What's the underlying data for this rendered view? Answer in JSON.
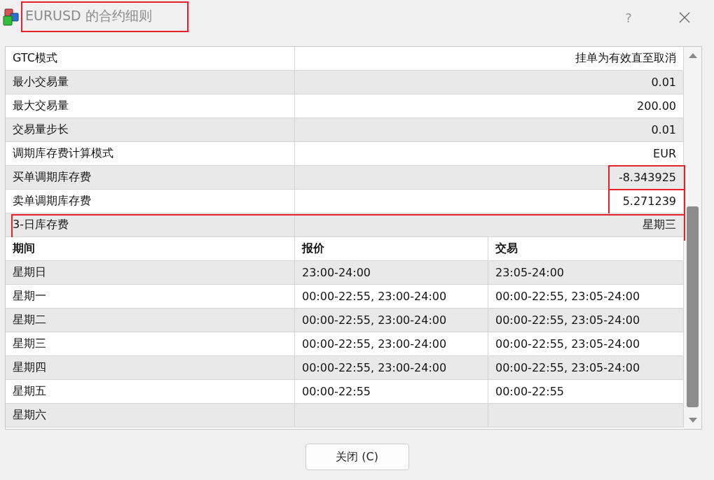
{
  "window": {
    "title": "EURUSD 的合约细则",
    "title_highlighted": true,
    "help": "?"
  },
  "specs": [
    {
      "label": "GTC模式",
      "value": "挂单为有效直至取消",
      "value_highlighted": false,
      "row_highlighted": false
    },
    {
      "label": "最小交易量",
      "value": "0.01",
      "value_highlighted": false,
      "row_highlighted": false
    },
    {
      "label": "最大交易量",
      "value": "200.00",
      "value_highlighted": false,
      "row_highlighted": false
    },
    {
      "label": "交易量步长",
      "value": "0.01",
      "value_highlighted": false,
      "row_highlighted": false
    },
    {
      "label": "调期库存费计算模式",
      "value": "EUR",
      "value_highlighted": false,
      "row_highlighted": false
    },
    {
      "label": "买单调期库存费",
      "value": "-8.343925",
      "value_highlighted": true,
      "row_highlighted": false
    },
    {
      "label": "卖单调期库存费",
      "value": "5.271239",
      "value_highlighted": true,
      "row_highlighted": false
    },
    {
      "label": "3-日库存费",
      "value": "星期三",
      "value_highlighted": false,
      "row_highlighted": true
    }
  ],
  "sessions": {
    "columns": [
      "期间",
      "报价",
      "交易"
    ],
    "rows": [
      {
        "day": "星期日",
        "quotes": "23:00-24:00",
        "trade": "23:05-24:00"
      },
      {
        "day": "星期一",
        "quotes": "00:00-22:55, 23:00-24:00",
        "trade": "00:00-22:55, 23:05-24:00"
      },
      {
        "day": "星期二",
        "quotes": "00:00-22:55, 23:00-24:00",
        "trade": "00:00-22:55, 23:05-24:00"
      },
      {
        "day": "星期三",
        "quotes": "00:00-22:55, 23:00-24:00",
        "trade": "00:00-22:55, 23:05-24:00"
      },
      {
        "day": "星期四",
        "quotes": "00:00-22:55, 23:00-24:00",
        "trade": "00:00-22:55, 23:05-24:00"
      },
      {
        "day": "星期五",
        "quotes": "00:00-22:55",
        "trade": "00:00-22:55"
      },
      {
        "day": "星期六"
      }
    ]
  },
  "close_button": "关闭 (C)"
}
